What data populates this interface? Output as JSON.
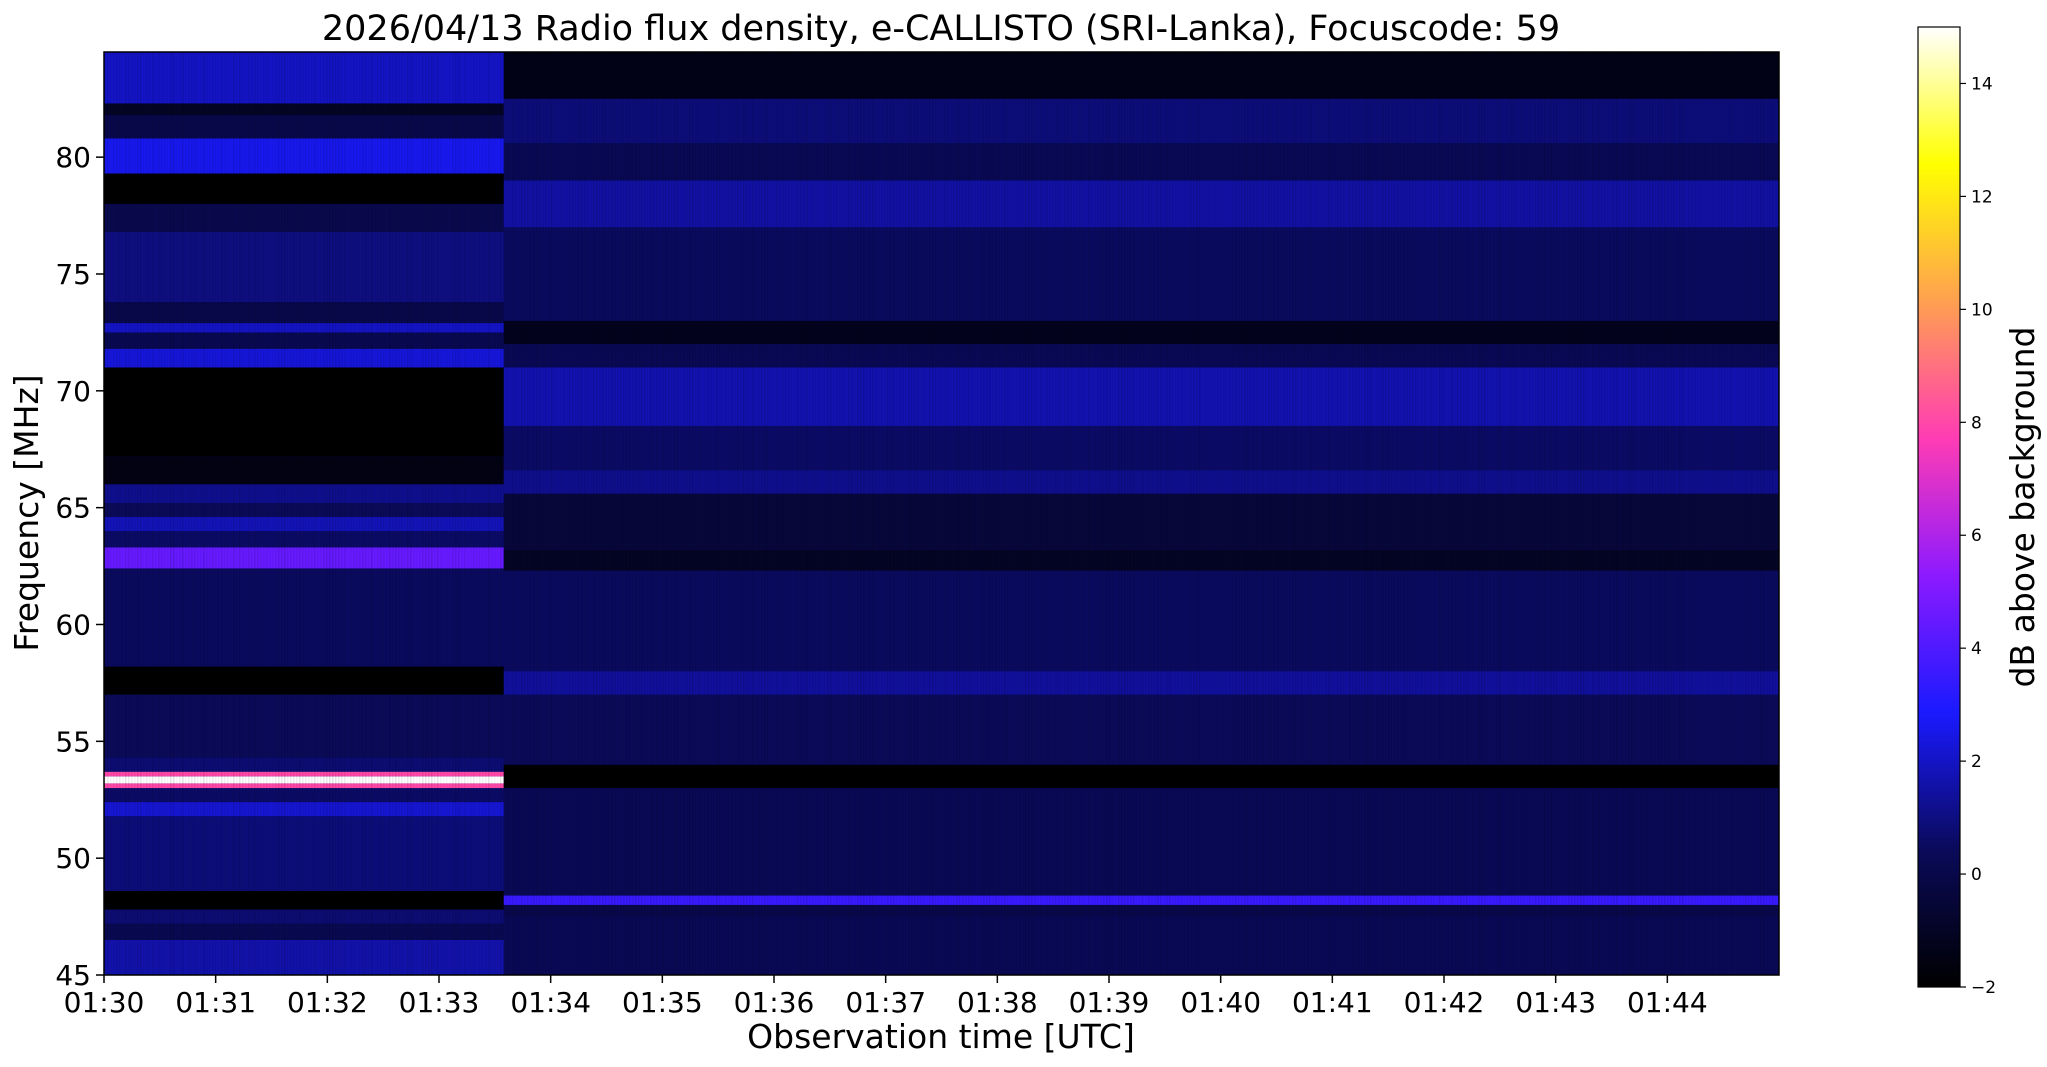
{
  "chart_data": {
    "type": "heatmap",
    "title": "2026/04/13  Radio flux density, e-CALLISTO (SRI-Lanka), Focuscode: 59",
    "xlabel": "Observation time [UTC]",
    "ylabel": "Frequency [MHz]",
    "x_tick_labels": [
      "01:30",
      "01:31",
      "01:32",
      "01:33",
      "01:34",
      "01:35",
      "01:36",
      "01:37",
      "01:38",
      "01:39",
      "01:40",
      "01:41",
      "01:42",
      "01:43",
      "01:44"
    ],
    "x_range_minutes": [
      0,
      15
    ],
    "y_ticks": [
      45,
      50,
      55,
      60,
      65,
      70,
      75,
      80
    ],
    "y_tick_labels": [
      "45",
      "50",
      "55",
      "60",
      "65",
      "70",
      "75",
      "80"
    ],
    "ylim": [
      45,
      84.5
    ],
    "colorbar": {
      "label": "dB above background",
      "range": [
        -2,
        15
      ],
      "ticks": [
        -2,
        0,
        2,
        4,
        6,
        8,
        10,
        12,
        14
      ],
      "tick_labels": [
        "−2",
        "0",
        "2",
        "4",
        "6",
        "8",
        "10",
        "12",
        "14"
      ],
      "colormap": [
        "#000000",
        "#0a0a5a",
        "#1a1aff",
        "#8c1aff",
        "#ff3cb4",
        "#ffa050",
        "#ffff00",
        "#ffffff"
      ]
    },
    "segment_change_minute": 3.58,
    "bands_segment_1": [
      {
        "f0": 45.0,
        "f1": 46.5,
        "db": 1.6
      },
      {
        "f0": 46.5,
        "f1": 47.2,
        "db": 0.2
      },
      {
        "f0": 47.2,
        "f1": 47.8,
        "db": 0.8
      },
      {
        "f0": 47.8,
        "f1": 48.6,
        "db": -2.0
      },
      {
        "f0": 48.6,
        "f1": 51.8,
        "db": 0.9
      },
      {
        "f0": 51.8,
        "f1": 52.4,
        "db": 2.2
      },
      {
        "f0": 52.4,
        "f1": 53.0,
        "db": 0.6
      },
      {
        "f0": 53.0,
        "f1": 53.2,
        "db": 8.0
      },
      {
        "f0": 53.2,
        "f1": 53.5,
        "db": 15.0
      },
      {
        "f0": 53.5,
        "f1": 53.7,
        "db": 8.0
      },
      {
        "f0": 53.7,
        "f1": 54.3,
        "db": 0.8
      },
      {
        "f0": 54.3,
        "f1": 57.0,
        "db": 0.4
      },
      {
        "f0": 57.0,
        "f1": 58.2,
        "db": -2.0
      },
      {
        "f0": 58.2,
        "f1": 62.4,
        "db": 0.5
      },
      {
        "f0": 62.4,
        "f1": 63.3,
        "db": 4.5
      },
      {
        "f0": 63.3,
        "f1": 64.0,
        "db": 0.6
      },
      {
        "f0": 64.0,
        "f1": 64.6,
        "db": 1.8
      },
      {
        "f0": 64.6,
        "f1": 65.2,
        "db": 0.4
      },
      {
        "f0": 65.2,
        "f1": 66.0,
        "db": 1.2
      },
      {
        "f0": 66.0,
        "f1": 67.2,
        "db": -1.5
      },
      {
        "f0": 67.2,
        "f1": 71.0,
        "db": -2.0
      },
      {
        "f0": 71.0,
        "f1": 71.8,
        "db": 2.3
      },
      {
        "f0": 71.8,
        "f1": 72.5,
        "db": 0.2
      },
      {
        "f0": 72.5,
        "f1": 72.9,
        "db": 2.0
      },
      {
        "f0": 72.9,
        "f1": 73.8,
        "db": 0.0
      },
      {
        "f0": 73.8,
        "f1": 76.8,
        "db": 1.0
      },
      {
        "f0": 76.8,
        "f1": 78.0,
        "db": 0.1
      },
      {
        "f0": 78.0,
        "f1": 79.3,
        "db": -2.0
      },
      {
        "f0": 79.3,
        "f1": 80.8,
        "db": 2.6
      },
      {
        "f0": 80.8,
        "f1": 81.8,
        "db": 0.0
      },
      {
        "f0": 81.8,
        "f1": 82.3,
        "db": -1.0
      },
      {
        "f0": 82.3,
        "f1": 84.5,
        "db": 2.0
      }
    ],
    "bands_segment_2": [
      {
        "f0": 45.0,
        "f1": 47.5,
        "db": 0.3
      },
      {
        "f0": 47.5,
        "f1": 48.0,
        "db": 0.0
      },
      {
        "f0": 48.0,
        "f1": 48.4,
        "db": 3.5
      },
      {
        "f0": 48.4,
        "f1": 53.0,
        "db": 0.3
      },
      {
        "f0": 53.0,
        "f1": 54.0,
        "db": -2.0
      },
      {
        "f0": 54.0,
        "f1": 57.0,
        "db": 0.4
      },
      {
        "f0": 57.0,
        "f1": 58.0,
        "db": 1.4
      },
      {
        "f0": 58.0,
        "f1": 62.3,
        "db": 0.5
      },
      {
        "f0": 62.3,
        "f1": 63.2,
        "db": -1.0
      },
      {
        "f0": 63.2,
        "f1": 65.6,
        "db": -0.4
      },
      {
        "f0": 65.6,
        "f1": 66.6,
        "db": 1.2
      },
      {
        "f0": 66.6,
        "f1": 68.5,
        "db": 0.6
      },
      {
        "f0": 68.5,
        "f1": 71.0,
        "db": 1.7
      },
      {
        "f0": 71.0,
        "f1": 72.0,
        "db": 0.3
      },
      {
        "f0": 72.0,
        "f1": 73.0,
        "db": -1.2
      },
      {
        "f0": 73.0,
        "f1": 77.0,
        "db": 0.5
      },
      {
        "f0": 77.0,
        "f1": 79.0,
        "db": 1.5
      },
      {
        "f0": 79.0,
        "f1": 80.6,
        "db": 0.3
      },
      {
        "f0": 80.6,
        "f1": 82.5,
        "db": 0.9
      },
      {
        "f0": 82.5,
        "f1": 84.5,
        "db": -1.4
      }
    ]
  }
}
